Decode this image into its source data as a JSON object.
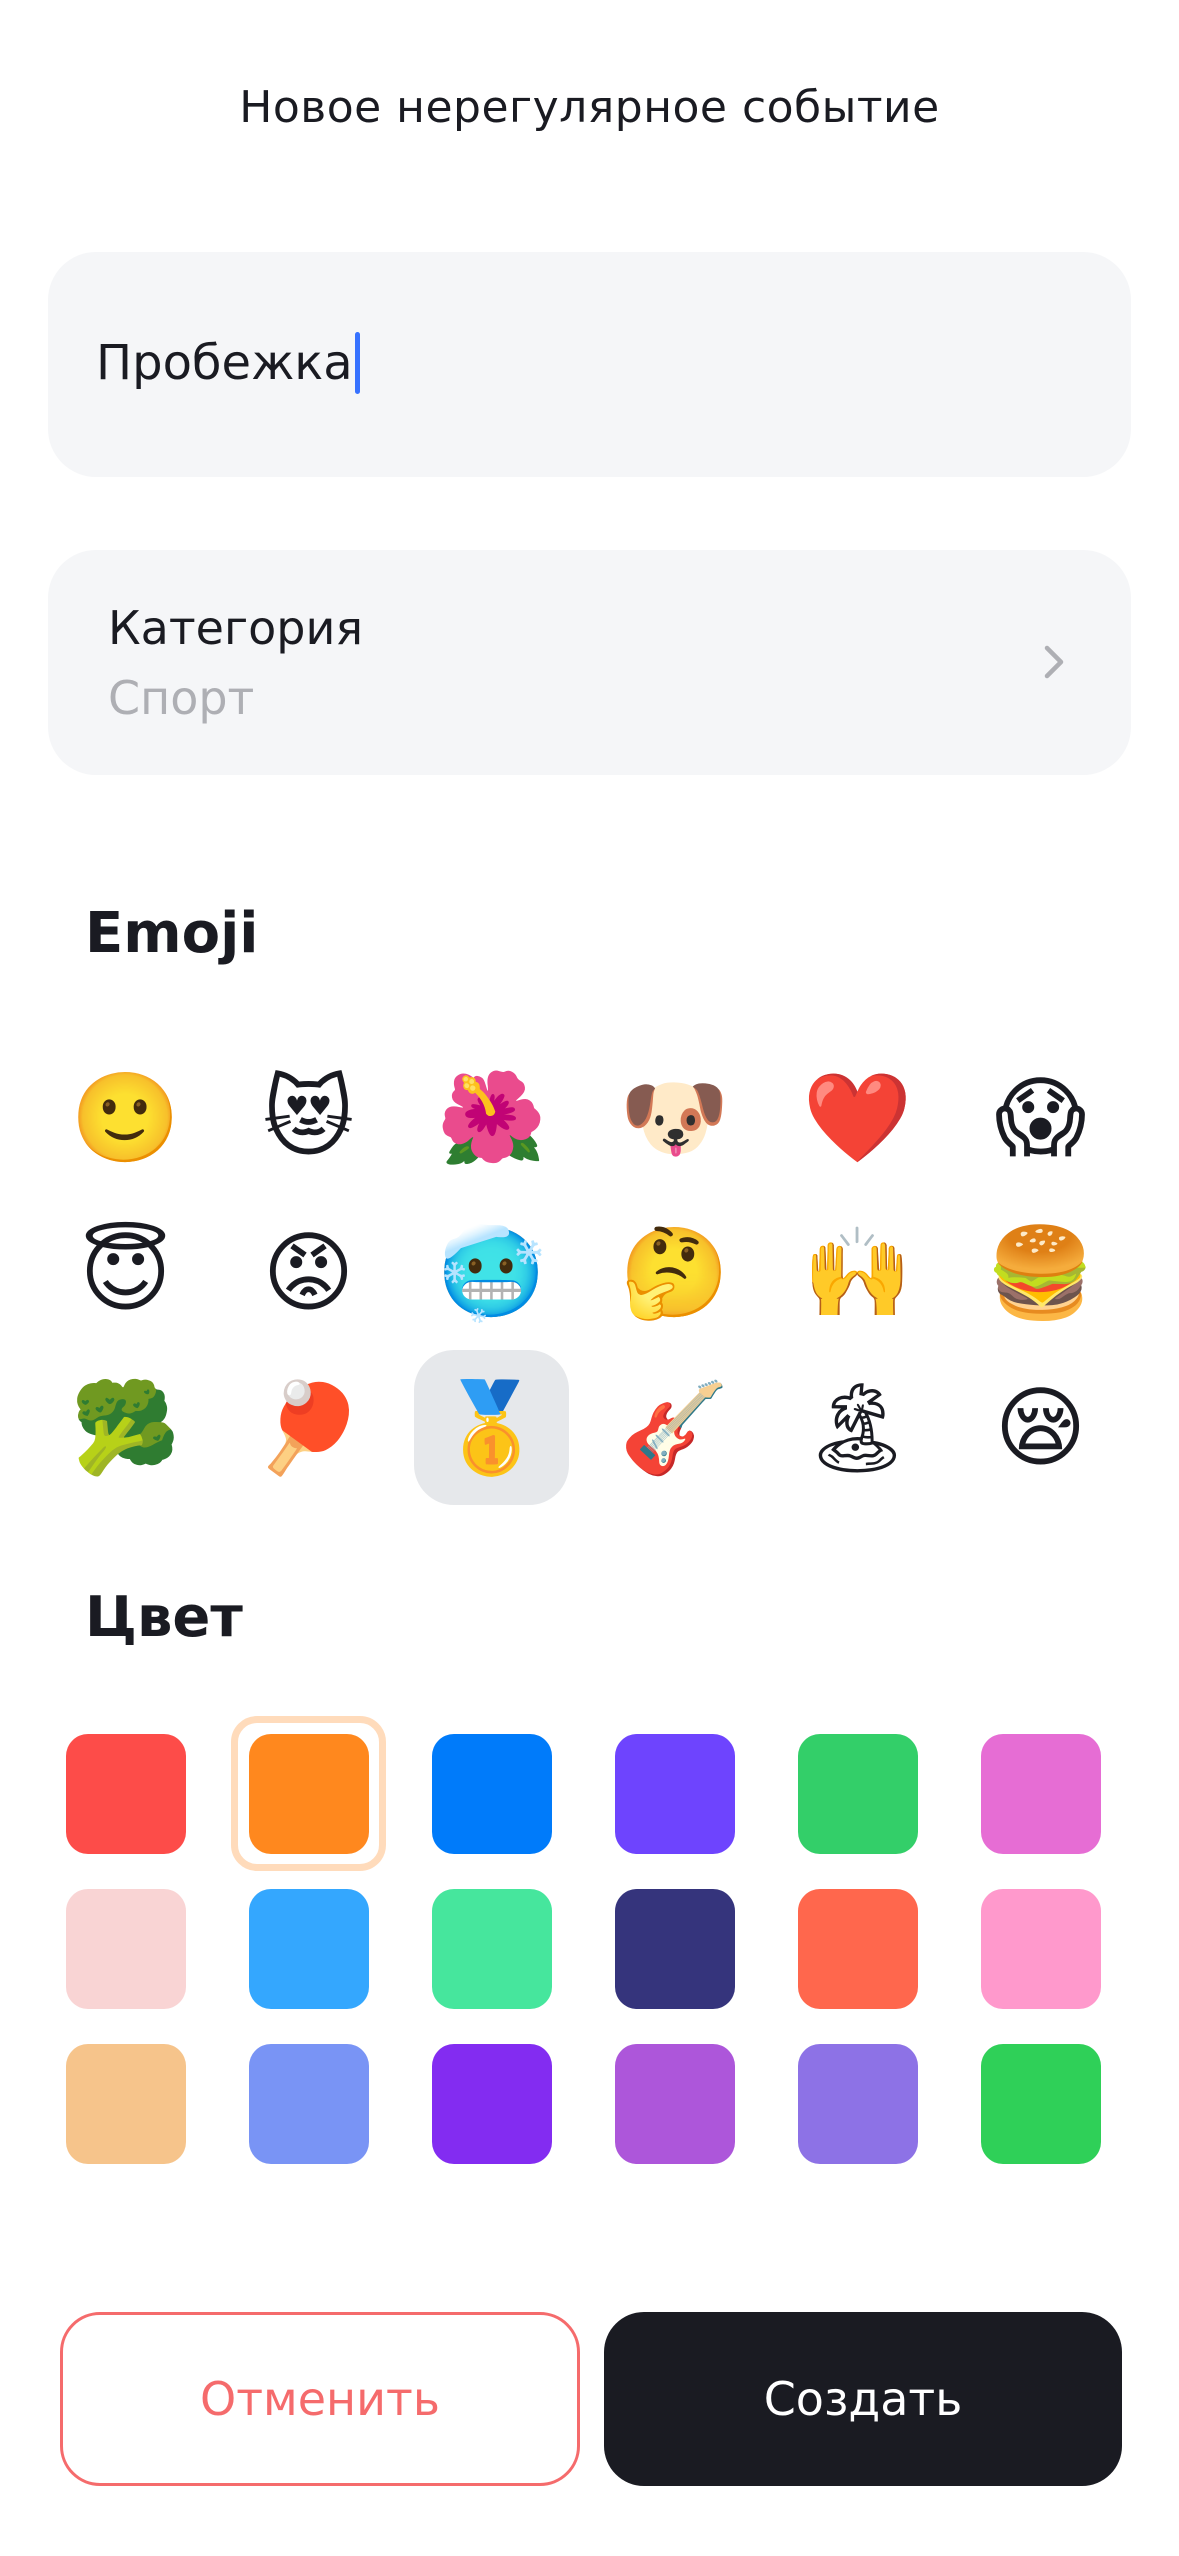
{
  "header": {
    "title": "Новое нерегулярное событие"
  },
  "name_field": {
    "value": "Пробежка"
  },
  "category": {
    "title": "Категория",
    "value": "Спорт"
  },
  "emoji_section": {
    "title": "Emoji",
    "items": [
      {
        "glyph": "🙂",
        "name": "slightly-smiling-face"
      },
      {
        "glyph": "😻",
        "name": "heart-eyes-cat"
      },
      {
        "glyph": "🌺",
        "name": "hibiscus"
      },
      {
        "glyph": "🐶",
        "name": "dog-face"
      },
      {
        "glyph": "❤️",
        "name": "red-heart"
      },
      {
        "glyph": "😱",
        "name": "screaming-face"
      },
      {
        "glyph": "😇",
        "name": "smiling-face-with-halo"
      },
      {
        "glyph": "😡",
        "name": "pouting-face"
      },
      {
        "glyph": "🥶",
        "name": "cold-face"
      },
      {
        "glyph": "🤔",
        "name": "thinking-face"
      },
      {
        "glyph": "🙌",
        "name": "raising-hands"
      },
      {
        "glyph": "🍔",
        "name": "hamburger"
      },
      {
        "glyph": "🥦",
        "name": "broccoli"
      },
      {
        "glyph": "🏓",
        "name": "ping-pong"
      },
      {
        "glyph": "🥇",
        "name": "first-place-medal",
        "selected": true
      },
      {
        "glyph": "🎸",
        "name": "guitar"
      },
      {
        "glyph": "🏝",
        "name": "desert-island"
      },
      {
        "glyph": "😪",
        "name": "sleepy-face"
      }
    ]
  },
  "color_section": {
    "title": "Цвет",
    "colors": [
      {
        "hex": "#FD4C49"
      },
      {
        "hex": "#FF881E",
        "selected": true
      },
      {
        "hex": "#007BFA"
      },
      {
        "hex": "#6E44FE"
      },
      {
        "hex": "#33CF69"
      },
      {
        "hex": "#E66DD4"
      },
      {
        "hex": "#F9D4D4"
      },
      {
        "hex": "#34A7FE"
      },
      {
        "hex": "#46E69D"
      },
      {
        "hex": "#35347C"
      },
      {
        "hex": "#FF674D"
      },
      {
        "hex": "#FF99CC"
      },
      {
        "hex": "#F6C48B"
      },
      {
        "hex": "#7994F5"
      },
      {
        "hex": "#832CF1"
      },
      {
        "hex": "#AD56DA"
      },
      {
        "hex": "#8D72E6"
      },
      {
        "hex": "#2FD058"
      }
    ]
  },
  "actions": {
    "cancel_label": "Отменить",
    "create_label": "Создать",
    "cancel_color": "#F56B6C",
    "create_color": "#1A1B22"
  }
}
